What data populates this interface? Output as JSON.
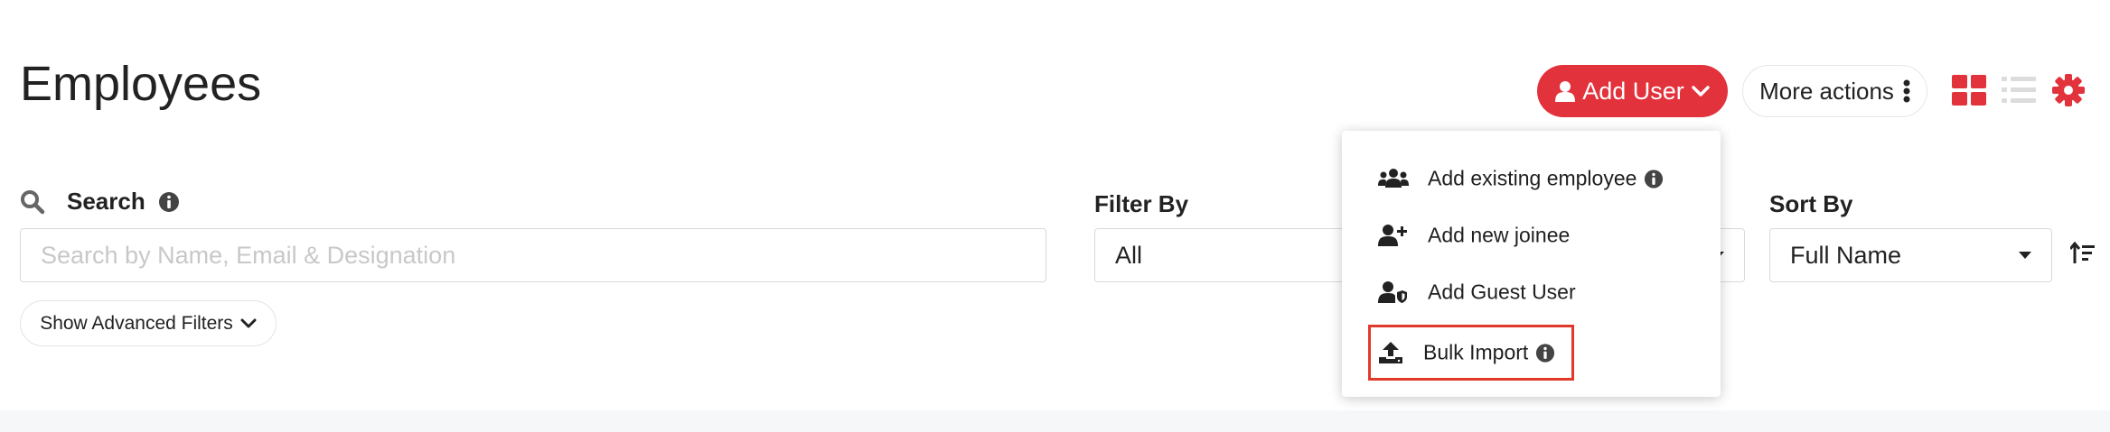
{
  "page": {
    "title": "Employees"
  },
  "header": {
    "add_user_label": "Add User",
    "more_actions_label": "More actions",
    "view_toggle": [
      "grid-view-icon",
      "list-view-icon"
    ],
    "settings_icon": "gear-icon"
  },
  "dropdown": {
    "items": [
      {
        "label": "Add existing employee",
        "icon": "users-group-icon",
        "info": true
      },
      {
        "label": "Add new joinee",
        "icon": "user-plus-icon",
        "info": false
      },
      {
        "label": "Add Guest User",
        "icon": "user-shield-icon",
        "info": false
      },
      {
        "label": "Bulk Import",
        "icon": "upload-icon",
        "info": true,
        "highlighted": true
      }
    ]
  },
  "search": {
    "label": "Search",
    "placeholder": "Search by Name, Email & Designation",
    "value": ""
  },
  "filters": {
    "advanced_label": "Show Advanced Filters",
    "filter_by_label": "Filter By",
    "filter_by_value": "All",
    "sort_by_label": "Sort By",
    "sort_by_value": "Full Name"
  },
  "colors": {
    "accent": "#e2323c",
    "highlight_border": "#e23a2a",
    "footer_band": "#f6f7f9"
  }
}
